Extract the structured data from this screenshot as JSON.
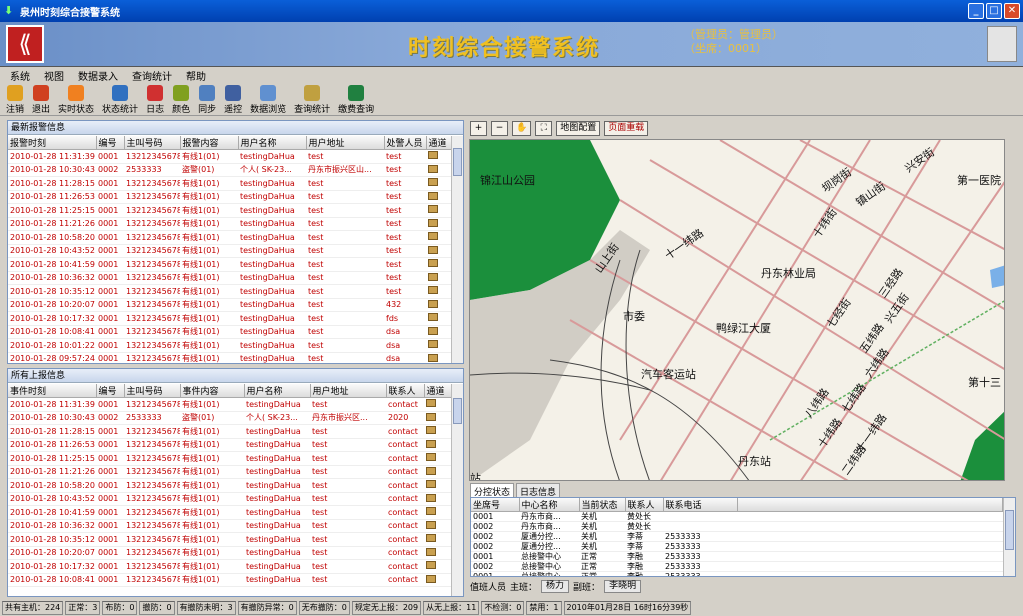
{
  "window": {
    "title": "泉州时刻综合接警系统"
  },
  "banner": {
    "title": "时刻综合接警系统",
    "manager": "（管理员：管理员）",
    "seat": "（坐席：0001）"
  },
  "menu": [
    "系统",
    "视图",
    "数据录入",
    "查询统计",
    "帮助"
  ],
  "toolbar": [
    {
      "label": "注销",
      "icon": "key-icon",
      "color": "#e0a020"
    },
    {
      "label": "退出",
      "icon": "exit-icon",
      "color": "#d04020"
    },
    {
      "label": "实时状态",
      "icon": "refresh-icon",
      "color": "#f08020"
    },
    {
      "label": "状态统计",
      "icon": "bar-chart-icon",
      "color": "#3070c0"
    },
    {
      "label": "日志",
      "icon": "book-icon",
      "color": "#d03030"
    },
    {
      "label": "颜色",
      "icon": "palette-icon",
      "color": "#80a020"
    },
    {
      "label": "同步",
      "icon": "clock-icon",
      "color": "#5080c0"
    },
    {
      "label": "遥控",
      "icon": "network-icon",
      "color": "#4060a0"
    },
    {
      "label": "数据浏览",
      "icon": "magnifier-icon",
      "color": "#6090d0"
    },
    {
      "label": "查询统计",
      "icon": "report-icon",
      "color": "#c0a040"
    },
    {
      "label": "缴费查询",
      "icon": "excel-icon",
      "color": "#208040"
    }
  ],
  "alarms": {
    "title": "最新报警信息",
    "columns": [
      "报警时刻",
      "编号",
      "主叫号码",
      "报警内容",
      "用户名称",
      "用户地址",
      "处警人员",
      "通道"
    ],
    "rows": [
      [
        "2010-01-28 11:31:39",
        "0001",
        "13212345678",
        "有线1(01)",
        "testingDaHua",
        "test",
        "test"
      ],
      [
        "2010-01-28 10:30:43",
        "0002",
        "2533333",
        "盗警(01)",
        "个人( SK-23...",
        "丹东市振兴区山...",
        "test"
      ],
      [
        "2010-01-28 11:28:15",
        "0001",
        "13212345678",
        "有线1(01)",
        "testingDaHua",
        "test",
        "test"
      ],
      [
        "2010-01-28 11:26:53",
        "0001",
        "13212345678",
        "有线1(01)",
        "testingDaHua",
        "test",
        "test"
      ],
      [
        "2010-01-28 11:25:15",
        "0001",
        "13212345678",
        "有线1(01)",
        "testingDaHua",
        "test",
        "test"
      ],
      [
        "2010-01-28 11:21:26",
        "0001",
        "13212345678",
        "有线1(01)",
        "testingDaHua",
        "test",
        "test"
      ],
      [
        "2010-01-28 10:58:20",
        "0001",
        "13212345678",
        "有线1(01)",
        "testingDaHua",
        "test",
        "test"
      ],
      [
        "2010-01-28 10:43:52",
        "0001",
        "13212345678",
        "有线1(01)",
        "testingDaHua",
        "test",
        "test"
      ],
      [
        "2010-01-28 10:41:59",
        "0001",
        "13212345678",
        "有线1(01)",
        "testingDaHua",
        "test",
        "test"
      ],
      [
        "2010-01-28 10:36:32",
        "0001",
        "13212345678",
        "有线1(01)",
        "testingDaHua",
        "test",
        "test"
      ],
      [
        "2010-01-28 10:35:12",
        "0001",
        "13212345678",
        "有线1(01)",
        "testingDaHua",
        "test",
        "test"
      ],
      [
        "2010-01-28 10:20:07",
        "0001",
        "13212345678",
        "有线1(01)",
        "testingDaHua",
        "test",
        "432"
      ],
      [
        "2010-01-28 10:17:32",
        "0001",
        "13212345678",
        "有线1(01)",
        "testingDaHua",
        "test",
        "fds"
      ],
      [
        "2010-01-28 10:08:41",
        "0001",
        "13212345678",
        "有线1(01)",
        "testingDaHua",
        "test",
        "dsa"
      ],
      [
        "2010-01-28 10:01:22",
        "0001",
        "13212345678",
        "有线1(01)",
        "testingDaHua",
        "test",
        "dsa"
      ],
      [
        "2010-01-28 09:57:24",
        "0001",
        "13212345678",
        "有线1(01)",
        "testingDaHua",
        "test",
        "dsa"
      ]
    ]
  },
  "reports": {
    "title": "所有上报信息",
    "columns": [
      "事件时刻",
      "编号",
      "主叫号码",
      "事件内容",
      "用户名称",
      "用户地址",
      "联系人",
      "通道"
    ],
    "rows": [
      [
        "2010-01-28 11:31:39",
        "0001",
        "13212345678",
        "有线1(01)",
        "testingDaHua",
        "test",
        "contact"
      ],
      [
        "2010-01-28 10:30:43",
        "0002",
        "2533333",
        "盗警(01)",
        "个人( SK-23...",
        "丹东市振兴区...",
        "2020"
      ],
      [
        "2010-01-28 11:28:15",
        "0001",
        "13212345678",
        "有线1(01)",
        "testingDaHua",
        "test",
        "contact"
      ],
      [
        "2010-01-28 11:26:53",
        "0001",
        "13212345678",
        "有线1(01)",
        "testingDaHua",
        "test",
        "contact"
      ],
      [
        "2010-01-28 11:25:15",
        "0001",
        "13212345678",
        "有线1(01)",
        "testingDaHua",
        "test",
        "contact"
      ],
      [
        "2010-01-28 11:21:26",
        "0001",
        "13212345678",
        "有线1(01)",
        "testingDaHua",
        "test",
        "contact"
      ],
      [
        "2010-01-28 10:58:20",
        "0001",
        "13212345678",
        "有线1(01)",
        "testingDaHua",
        "test",
        "contact"
      ],
      [
        "2010-01-28 10:43:52",
        "0001",
        "13212345678",
        "有线1(01)",
        "testingDaHua",
        "test",
        "contact"
      ],
      [
        "2010-01-28 10:41:59",
        "0001",
        "13212345678",
        "有线1(01)",
        "testingDaHua",
        "test",
        "contact"
      ],
      [
        "2010-01-28 10:36:32",
        "0001",
        "13212345678",
        "有线1(01)",
        "testingDaHua",
        "test",
        "contact"
      ],
      [
        "2010-01-28 10:35:12",
        "0001",
        "13212345678",
        "有线1(01)",
        "testingDaHua",
        "test",
        "contact"
      ],
      [
        "2010-01-28 10:20:07",
        "0001",
        "13212345678",
        "有线1(01)",
        "testingDaHua",
        "test",
        "contact"
      ],
      [
        "2010-01-28 10:17:32",
        "0001",
        "13212345678",
        "有线1(01)",
        "testingDaHua",
        "test",
        "contact"
      ],
      [
        "2010-01-28 10:08:41",
        "0001",
        "13212345678",
        "有线1(01)",
        "testingDaHua",
        "test",
        "contact"
      ]
    ]
  },
  "map_tools": {
    "zoom_in": "+",
    "zoom_out": "−",
    "pan": "✋",
    "full": "⛶",
    "config": "地图配置",
    "reload": "页面重载"
  },
  "map_labels": [
    {
      "text": "锦江山公园"
    },
    {
      "text": "第一医院"
    },
    {
      "text": "坝岗街"
    },
    {
      "text": "镇山街"
    },
    {
      "text": "兴安街"
    },
    {
      "text": "十纬街"
    },
    {
      "text": "十一纬路"
    },
    {
      "text": "丹东林业局"
    },
    {
      "text": "山上街"
    },
    {
      "text": "三经路"
    },
    {
      "text": "七经街"
    },
    {
      "text": "市委"
    },
    {
      "text": "鸭绿江大厦"
    },
    {
      "text": "五纬路"
    },
    {
      "text": "六纬路"
    },
    {
      "text": "汽车客运站"
    },
    {
      "text": "第十三"
    },
    {
      "text": "八纬路"
    },
    {
      "text": "七纬路"
    },
    {
      "text": "十纬路"
    },
    {
      "text": "十一纬路"
    },
    {
      "text": "二纬路"
    },
    {
      "text": "丹东站"
    },
    {
      "text": "站"
    },
    {
      "text": "兴五街"
    }
  ],
  "tabs": [
    "分控状态",
    "日志信息"
  ],
  "seats": {
    "columns": [
      "坐席号",
      "中心名称",
      "当前状态",
      "联系人",
      "联系电话"
    ],
    "rows": [
      [
        "0001",
        "丹东市商...",
        "关机",
        "黄处长",
        ""
      ],
      [
        "0002",
        "丹东市商...",
        "关机",
        "黄处长",
        ""
      ],
      [
        "0002",
        "厦通分控...",
        "关机",
        "李蒂",
        "2533333"
      ],
      [
        "0002",
        "厦通分控...",
        "关机",
        "李蒂",
        "2533333"
      ],
      [
        "0001",
        "总接警中心",
        "正常",
        "李融",
        "2533333"
      ],
      [
        "0002",
        "总接警中心",
        "正常",
        "李融",
        "2533333"
      ],
      [
        "0001",
        "总接警中心",
        "正常",
        "李融",
        "2533333"
      ]
    ]
  },
  "duty": {
    "label": "值班人员",
    "main_label": "主班：",
    "main": "杨力",
    "sub_label": "副班：",
    "sub": "李晓明"
  },
  "status": [
    "共有主机：224",
    "正常：3",
    "布防：0",
    "撤防：0",
    "有撤防未明：3",
    "有撤防异常：0",
    "无布撤防：0",
    "规定无上报：209",
    "从无上报：11",
    "不检测：0",
    "禁用：1",
    "2010年01月28日 16时16分39秒"
  ]
}
